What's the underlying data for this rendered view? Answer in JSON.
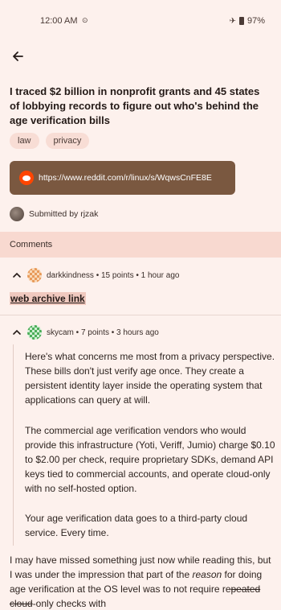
{
  "status": {
    "time": "12:00 AM",
    "battery": "97%"
  },
  "post": {
    "title": "I traced $2 billion in nonprofit grants and 45 states of lobbying records to figure out who's behind the age verification bills",
    "tags": [
      "law",
      "privacy"
    ],
    "link": "https://www.reddit.com/r/linux/s/WqwsCnFE8E",
    "submitted_by": "Submitted by rjzak"
  },
  "comments_label": "Comments",
  "comments": [
    {
      "meta": "darkkindness • 15 points • 1 hour ago",
      "link_text": "web archive link"
    },
    {
      "meta": "skycam • 7 points • 3 hours ago",
      "paragraphs": [
        "Here's what concerns me most from a privacy perspective. These bills don't just verify age once. They create a persistent identity layer inside the operating system that applications can query at will.",
        "The commercial age verification vendors who would provide this infrastructure (Yoti, Veriff, Jumio) charge $0.10 to $2.00 per check, require proprietary SDKs, demand API keys tied to commercial accounts, and operate cloud-only with no self-hosted option.",
        "Your age verification data goes to a third-party cloud service. Every time."
      ]
    }
  ],
  "reply": {
    "line1": "I may have missed something just now while reading this, but I was under the impression that part of the",
    "reason_word": "reason",
    "line2": "for doing age verification at the OS level",
    "line3a": "was to not require re",
    "line3b": "peated cloud",
    "line3c": "-only checks with"
  }
}
